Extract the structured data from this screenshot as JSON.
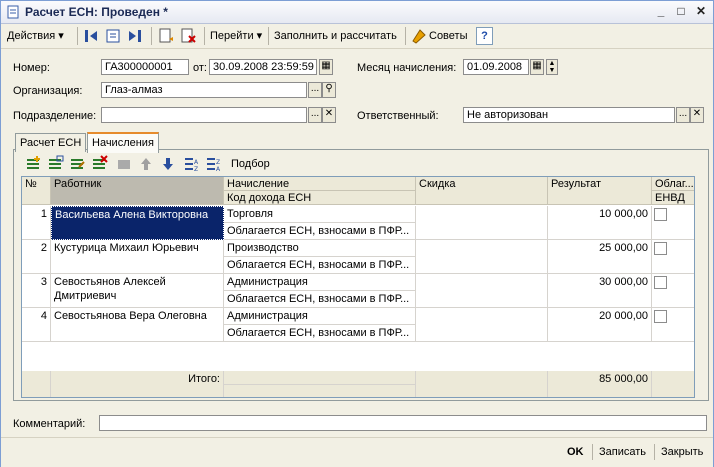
{
  "window": {
    "title": "Расчет ЕСН: Проведен *",
    "buttons": [
      "_",
      "□",
      "✕"
    ]
  },
  "toolbar": {
    "actions": "Действия ▾",
    "goto": "Перейти ▾",
    "fill_calc": "Заполнить и рассчитать",
    "tips": "Советы",
    "help": "?"
  },
  "header": {
    "number_label": "Номер:",
    "number_value": "ГА300000001",
    "from_label": "от:",
    "date_value": "30.09.2008 23:59:59",
    "month_label": "Месяц начисления:",
    "month_value": "01.09.2008",
    "org_label": "Организация:",
    "org_value": "Глаз-алмаз",
    "dept_label": "Подразделение:",
    "dept_value": "",
    "resp_label": "Ответственный:",
    "resp_value": "Не авторизован"
  },
  "tabs": [
    {
      "label": "Расчет ЕСН"
    },
    {
      "label": "Начисления"
    }
  ],
  "grid_toolbar": {
    "select_label": "Подбор"
  },
  "grid": {
    "columns": {
      "num": "№",
      "employee": "Работник",
      "accrual": "Начисление",
      "income_code": "Код дохода ЕСН",
      "discount": "Скидка",
      "result": "Результат",
      "envd": "Облаг...",
      "envd2": "ЕНВД"
    },
    "rows": [
      {
        "num": "1",
        "employee": "Васильева Алена Викторовна",
        "employee2": "",
        "accrual": "Торговля",
        "code": "Облагается ЕСН, взносами в ПФР...",
        "discount": "",
        "result": "10 000,00"
      },
      {
        "num": "2",
        "employee": "Кустурица Михаил Юрьевич",
        "employee2": "",
        "accrual": "Производство",
        "code": "Облагается ЕСН, взносами в ПФР...",
        "discount": "",
        "result": "25 000,00"
      },
      {
        "num": "3",
        "employee": "Севостьянов Алексей",
        "employee2": "Дмитриевич",
        "accrual": "Администрация",
        "code": "Облагается ЕСН, взносами в ПФР...",
        "discount": "",
        "result": "30 000,00"
      },
      {
        "num": "4",
        "employee": "Севостьянова Вера Олеговна",
        "employee2": "",
        "accrual": "Администрация",
        "code": "Облагается ЕСН, взносами в ПФР...",
        "discount": "",
        "result": "20 000,00"
      }
    ],
    "total_label": "Итого:",
    "total_value": "85 000,00"
  },
  "comment": {
    "label": "Комментарий:",
    "value": ""
  },
  "footer": {
    "ok": "OK",
    "save": "Записать",
    "close": "Закрыть"
  },
  "colors": {
    "selected_row": "#0a246a",
    "titlebar_text": "#1b2a55"
  }
}
